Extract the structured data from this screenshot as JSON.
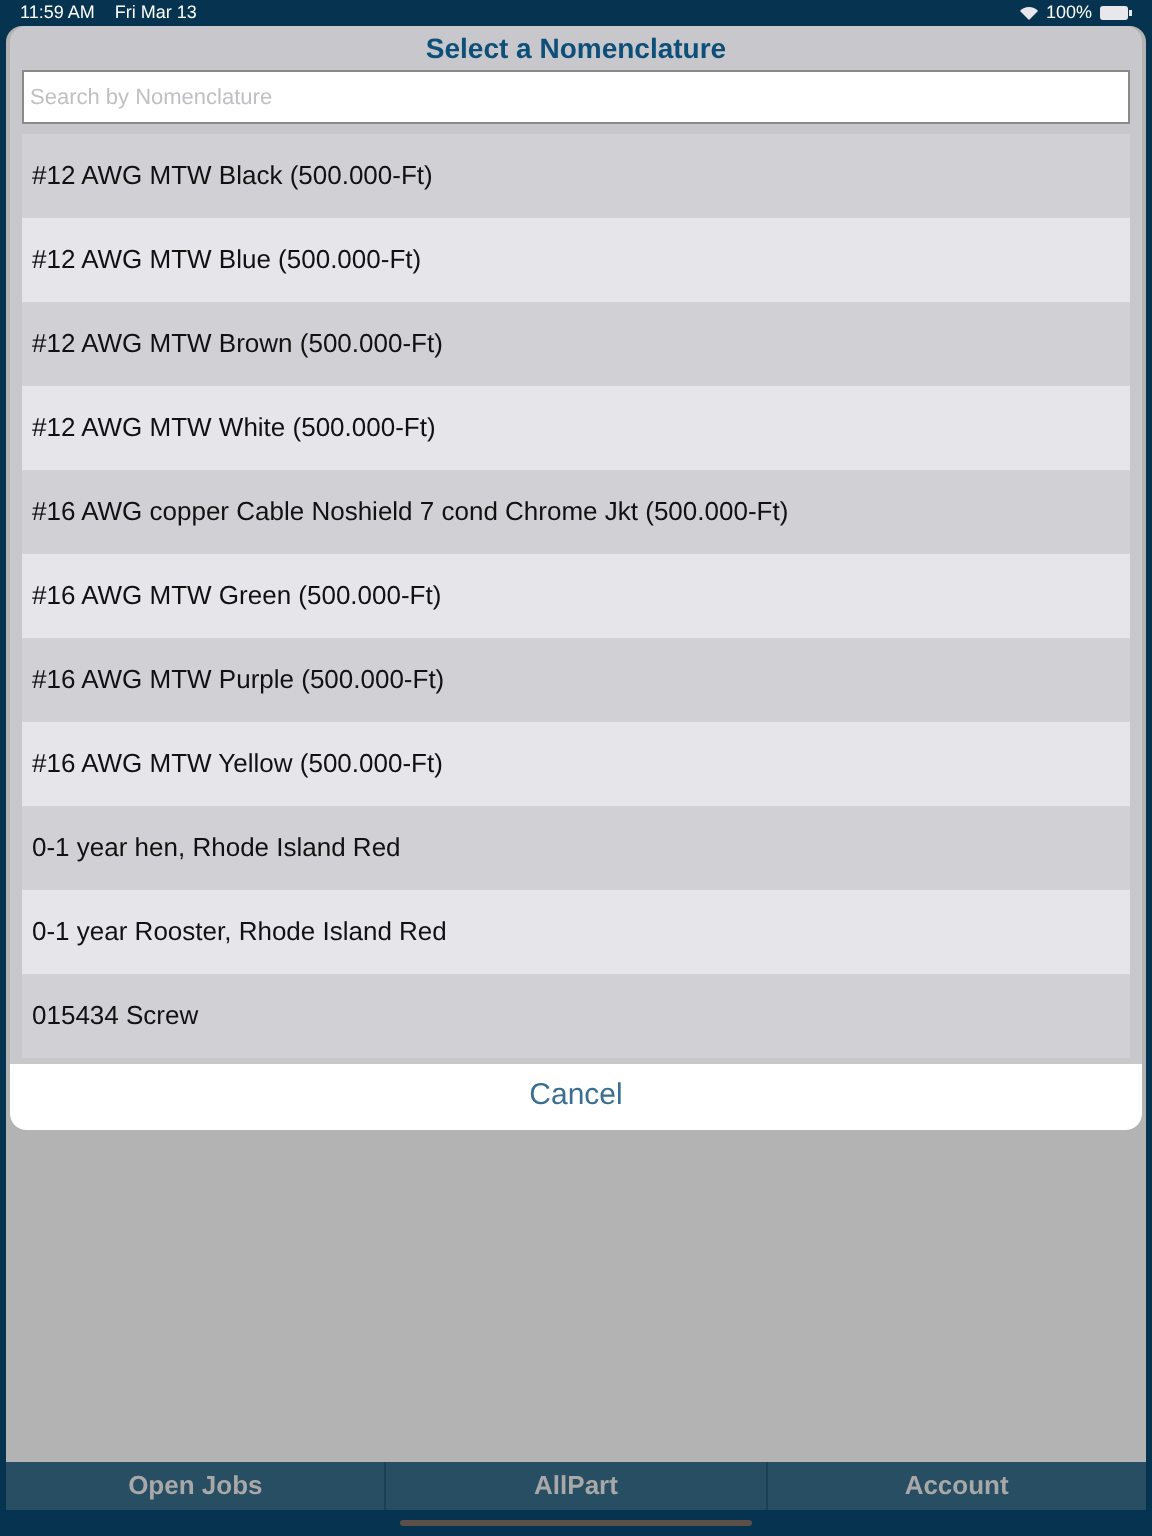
{
  "status_bar": {
    "time": "11:59 AM",
    "date": "Fri Mar 13",
    "battery": "100%"
  },
  "dialog": {
    "title": "Select a Nomenclature",
    "search": {
      "placeholder": "Search by Nomenclature"
    },
    "items": [
      "#12 AWG MTW Black (500.000-Ft)",
      "#12 AWG MTW Blue (500.000-Ft)",
      "#12 AWG MTW Brown (500.000-Ft)",
      "#12 AWG MTW White (500.000-Ft)",
      "#16 AWG copper Cable Noshield 7 cond Chrome Jkt (500.000-Ft)",
      "#16 AWG MTW Green (500.000-Ft)",
      "#16 AWG MTW Purple (500.000-Ft)",
      "#16 AWG MTW Yellow (500.000-Ft)",
      "0-1 year hen, Rhode Island Red",
      "0-1 year Rooster, Rhode Island Red",
      "015434 Screw"
    ],
    "cancel": "Cancel"
  },
  "tabs": [
    {
      "label": "Open Jobs"
    },
    {
      "label": "AllPart"
    },
    {
      "label": "Account"
    }
  ]
}
